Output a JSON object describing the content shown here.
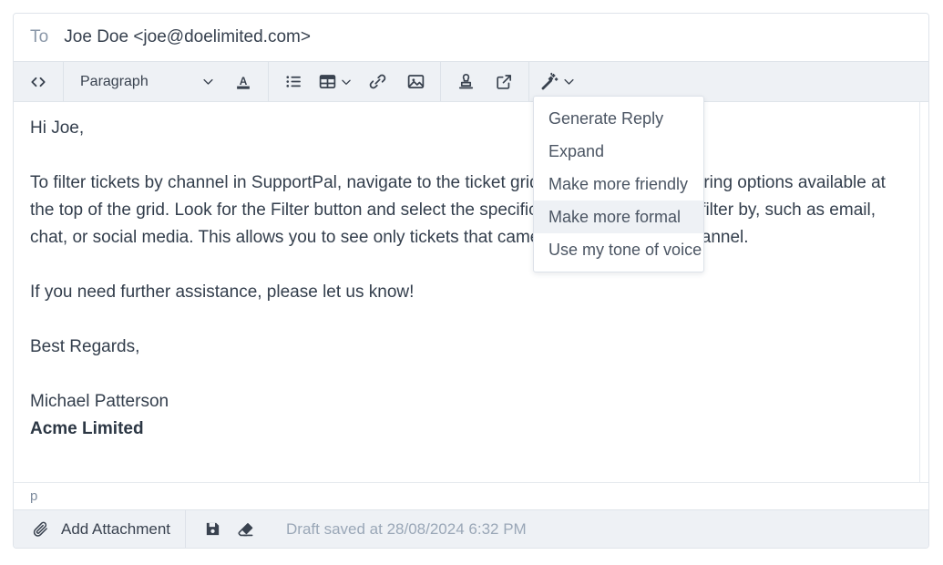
{
  "compose": {
    "to_label": "To",
    "to_value": "Joe Doe <joe@doelimited.com>"
  },
  "toolbar": {
    "source_code_title": "Source code",
    "paragraph_label": "Paragraph",
    "text_color_title": "Text color",
    "bullet_list_title": "Bulleted list",
    "table_title": "Table",
    "link_title": "Insert link",
    "image_title": "Insert image",
    "canned_response_title": "Canned response",
    "open_title": "Open in new window",
    "ai_title": "AI assistant"
  },
  "message": {
    "greeting": "Hi Joe,",
    "paragraph_1": "To filter tickets by channel in SupportPal, navigate to the ticket grid. You can use the filtering options available at the top of the grid. Look for the Filter button and select the specific channel you want to filter by, such as email, chat, or social media. This allows you to see only tickets that came from your chosen channel.",
    "paragraph_2": "If you need further assistance, please let us know!",
    "sign_off": "Best Regards,",
    "sender_name": "Michael Patterson",
    "sender_company": "Acme Limited"
  },
  "path_bar": {
    "path": "p"
  },
  "footer": {
    "add_attachment_label": "Add Attachment",
    "save_draft_title": "Save draft",
    "discard_draft_title": "Discard draft",
    "draft_status": "Draft saved at 28/08/2024 6:32 PM"
  },
  "ai_menu": {
    "items": [
      {
        "label": "Generate Reply",
        "active": false
      },
      {
        "label": "Expand",
        "active": false
      },
      {
        "label": "Make more friendly",
        "active": false
      },
      {
        "label": "Make more formal",
        "active": true
      },
      {
        "label": "Use my tone of voice",
        "active": false
      }
    ]
  },
  "colors": {
    "toolbar_bg": "#eef1f5",
    "border": "#dfe4ea",
    "text": "#333e4c",
    "muted": "#9aa7b7",
    "menu_hover": "#eef1f5"
  }
}
